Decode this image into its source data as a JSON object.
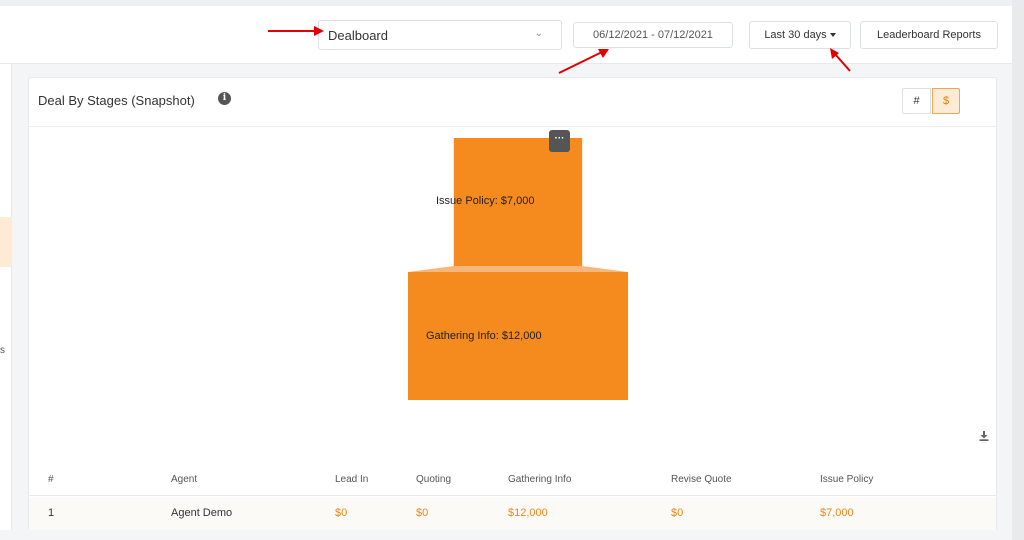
{
  "toolbar": {
    "report_select": {
      "value": "Dealboard"
    },
    "date_range": "06/12/2021 - 07/12/2021",
    "period_button": "Last 30 days",
    "leaderboard_button": "Leaderboard Reports"
  },
  "sidebar": {
    "partial_text": "s"
  },
  "card": {
    "title": "Deal By Stages (Snapshot)",
    "toggle": {
      "count_label": "#",
      "value_label": "$",
      "active": "$"
    }
  },
  "chart_data": {
    "type": "funnel",
    "stages": [
      {
        "label": "Issue Policy: $7,000",
        "stage": "Issue Policy",
        "value": 7000
      },
      {
        "label": "Gathering Info: $12,000",
        "stage": "Gathering Info",
        "value": 12000
      }
    ],
    "colors": {
      "fill": "#f58a1f",
      "connector": "#f7b77a"
    }
  },
  "table": {
    "columns": [
      "#",
      "Agent",
      "Lead In",
      "Quoting",
      "Gathering Info",
      "Revise Quote",
      "Issue Policy"
    ],
    "rows": [
      [
        "1",
        "Agent Demo",
        "$0",
        "$0",
        "$12,000",
        "$0",
        "$7,000"
      ]
    ]
  },
  "colors": {
    "accent": "#e8861a",
    "annotation_arrow": "#e00000"
  }
}
